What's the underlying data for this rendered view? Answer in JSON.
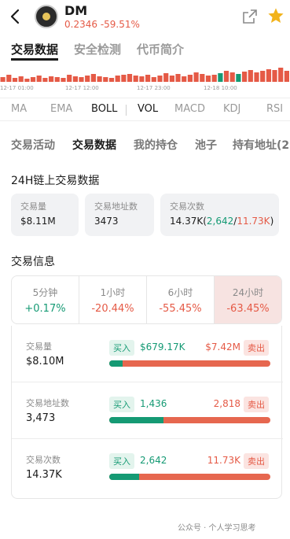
{
  "header": {
    "coin_name": "DM",
    "price": "0.2346",
    "change": "-59.51%"
  },
  "top_tabs": [
    "交易数据",
    "安全检测",
    "代币简介"
  ],
  "mini_chart": {
    "time_labels": [
      "12-17 01:00",
      "12-17 12:00",
      "12-17 23:00",
      "12-18 10:00"
    ]
  },
  "indicators": [
    "MA",
    "EMA",
    "BOLL",
    "VOL",
    "MACD",
    "KDJ",
    "RSI"
  ],
  "sub_tabs": [
    "交易活动",
    "交易数据",
    "我的持仓",
    "池子",
    "持有地址(2"
  ],
  "onchain": {
    "title": "24H链上交易数据",
    "cards": [
      {
        "label": "交易量",
        "value": "$8.11M"
      },
      {
        "label": "交易地址数",
        "value": "3473"
      },
      {
        "label": "交易次数",
        "value": "14.37K",
        "buy": "2,642",
        "sell": "11.73K"
      }
    ]
  },
  "trade_info": {
    "title": "交易信息",
    "periods": [
      {
        "label": "5分钟",
        "value": "+0.17%",
        "color": "#159a74"
      },
      {
        "label": "1小时",
        "value": "-20.44%",
        "color": "#e55a46"
      },
      {
        "label": "6小时",
        "value": "-55.45%",
        "color": "#e55a46"
      },
      {
        "label": "24小时",
        "value": "-63.45%",
        "color": "#e55a46"
      }
    ],
    "buy_label": "买入",
    "sell_label": "卖出",
    "rows": [
      {
        "label": "交易量",
        "value": "$8.10M",
        "buy": "$679.17K",
        "sell": "$7.42M",
        "buy_ratio": 0.084
      },
      {
        "label": "交易地址数",
        "value": "3,473",
        "buy": "1,436",
        "sell": "2,818",
        "buy_ratio": 0.338
      },
      {
        "label": "交易次数",
        "value": "14.37K",
        "buy": "2,642",
        "sell": "11.73K",
        "buy_ratio": 0.184
      }
    ]
  },
  "watermark": "公众号 · 个人学习思考",
  "colors": {
    "buy": "#159a74",
    "sell": "#e55a46"
  }
}
